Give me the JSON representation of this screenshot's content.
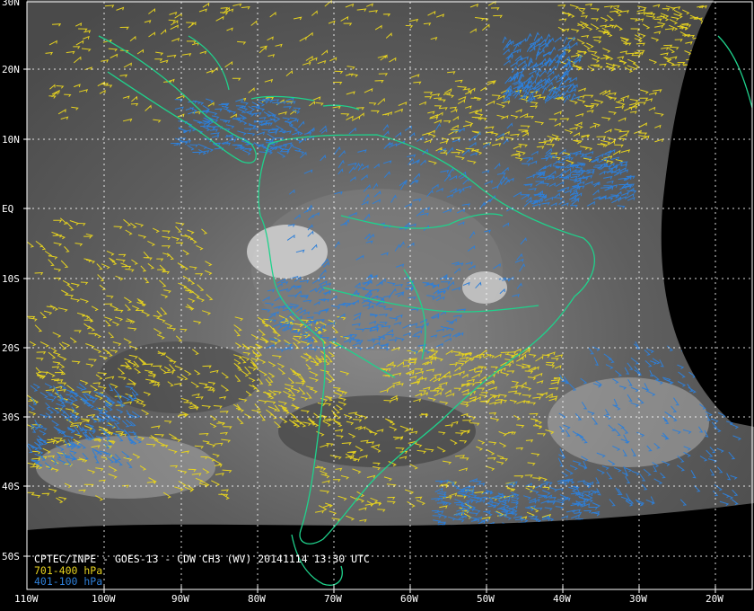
{
  "caption": {
    "title": "CPTEC/INPE - GOES-13 - CDW CH3 (WV) 20141114 13:30 UTC",
    "legend": [
      {
        "label": "701-400 hPa",
        "color": "#e6d21f"
      },
      {
        "label": "401-100 hPa",
        "color": "#2e7fd8"
      }
    ]
  },
  "axes": {
    "lat_labels": [
      "30N",
      "20N",
      "10N",
      "EQ",
      "10S",
      "20S",
      "30S",
      "40S",
      "50S"
    ],
    "lon_labels": [
      "110W",
      "100W",
      "90W",
      "80W",
      "70W",
      "60W",
      "50W",
      "40W",
      "30W",
      "20W"
    ]
  },
  "colors": {
    "background": "#000000",
    "imagery_dark": "#3a3a3a",
    "imagery_light": "#9a9a9a",
    "coastline": "#1fd28c",
    "graticule": "#ffffff",
    "frame": "#ffffff"
  }
}
